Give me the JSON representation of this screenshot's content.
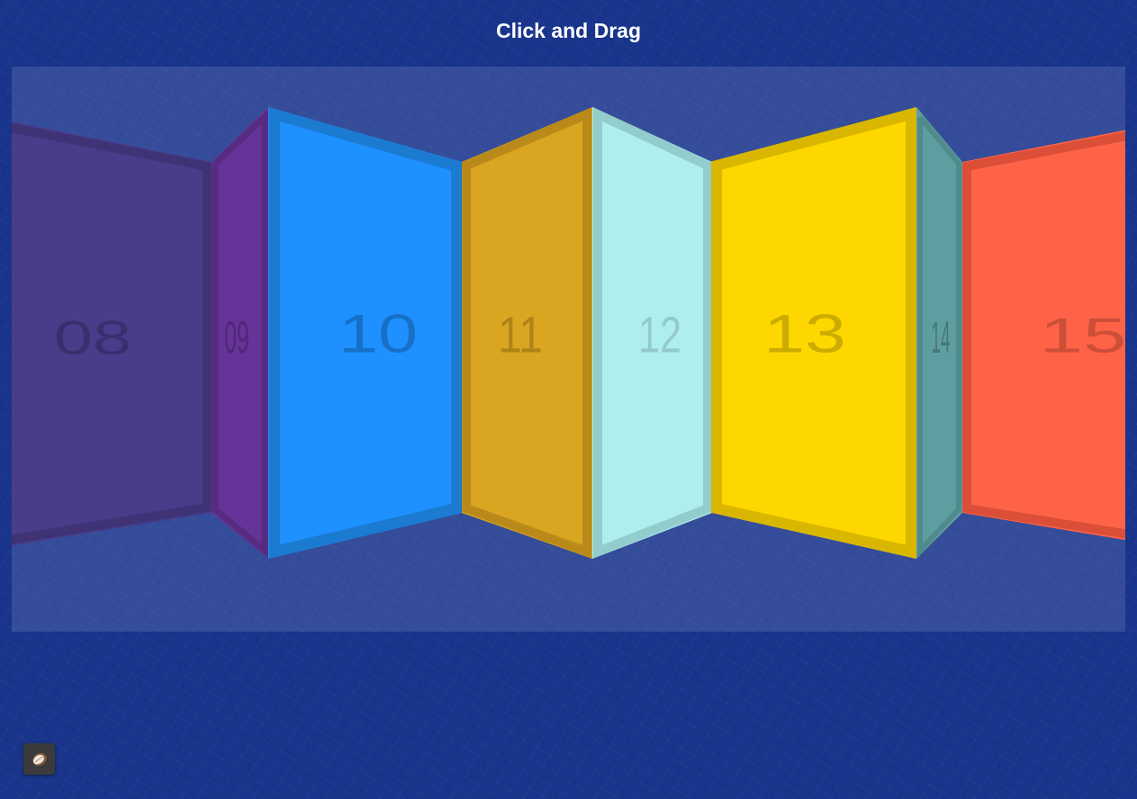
{
  "header": {
    "title": "Click and Drag"
  },
  "panels": [
    {
      "label": "08",
      "fill": "#483D8B",
      "border": "#3f3275"
    },
    {
      "label": "09",
      "fill": "#663399",
      "border": "#552c80"
    },
    {
      "label": "10",
      "fill": "#1E90FF",
      "border": "#1a7bd0"
    },
    {
      "label": "11",
      "fill": "#DAA520",
      "border": "#b98a1a"
    },
    {
      "label": "12",
      "fill": "#AFEEEE",
      "border": "#93cccc"
    },
    {
      "label": "13",
      "fill": "#FFD700",
      "border": "#d9b600"
    },
    {
      "label": "14",
      "fill": "#5F9EA0",
      "border": "#4f8a8c"
    },
    {
      "label": "15",
      "fill": "#FF6347",
      "border": "#db4f38"
    }
  ],
  "footer": {
    "corner_icon": "avatar-icon"
  }
}
